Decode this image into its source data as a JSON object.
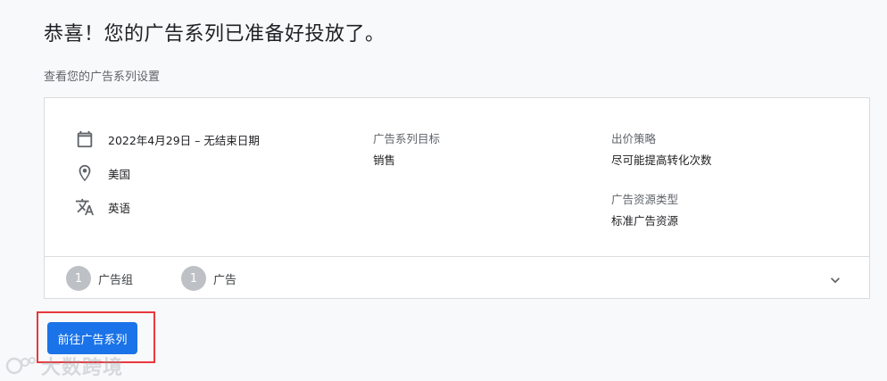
{
  "header": {
    "title": "恭喜！您的广告系列已准备好投放了。",
    "subtitle": "查看您的广告系列设置"
  },
  "summary": {
    "schedule": "2022年4月29日 – 无结束日期",
    "location": "美国",
    "language": "英语",
    "goal_label": "广告系列目标",
    "goal_value": "销售",
    "bidding_label": "出价策略",
    "bidding_value": "尽可能提高转化次数",
    "asset_type_label": "广告资源类型",
    "asset_type_value": "标准广告资源"
  },
  "counts": {
    "ad_groups_count": "1",
    "ad_groups_label": "广告组",
    "ads_count": "1",
    "ads_label": "广告"
  },
  "actions": {
    "go_to_campaign": "前往广告系列"
  },
  "watermark": {
    "text": "大数跨境"
  },
  "colors": {
    "primary": "#1a73e8",
    "highlight": "#e8383d",
    "chip": "#bdc1c6"
  },
  "icons": [
    "calendar-icon",
    "location-pin-icon",
    "translate-icon",
    "chevron-down-icon"
  ]
}
